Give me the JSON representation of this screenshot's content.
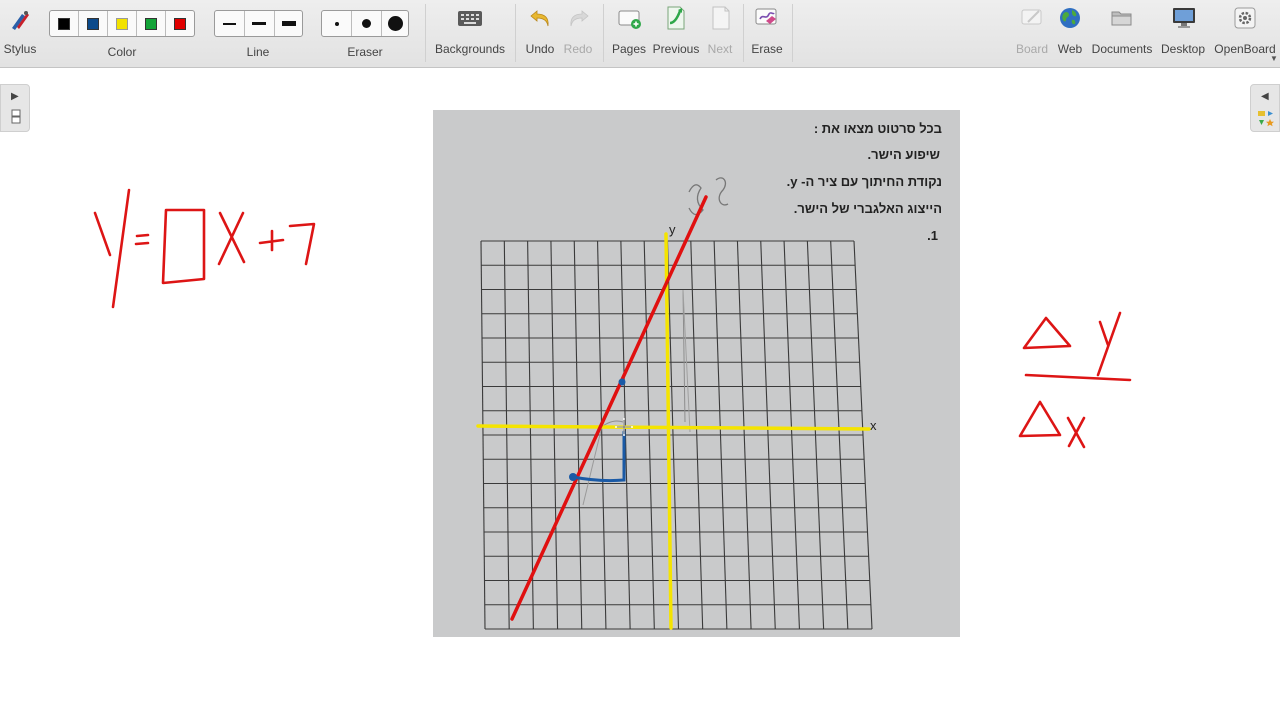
{
  "toolbar": {
    "stylus": "Stylus",
    "color": "Color",
    "line": "Line",
    "eraser": "Eraser",
    "backgrounds": "Backgrounds",
    "undo": "Undo",
    "redo": "Redo",
    "pages": "Pages",
    "previous": "Previous",
    "next": "Next",
    "erase": "Erase",
    "board": "Board",
    "web": "Web",
    "documents": "Documents",
    "desktop": "Desktop",
    "openboard": "OpenBoard"
  },
  "colors": [
    "#000000",
    "#0b4a8b",
    "#f2e200",
    "#13a338",
    "#e00000"
  ],
  "ink_colors": {
    "red": "#e01010",
    "yellow": "#f5e400",
    "blue": "#1a5aa6"
  },
  "worksheet": {
    "lines": [
      "בכל סרטוט מצאו את :",
      "שיפוע הישר.",
      "נקודת החיתוך עם ציר ה- y.",
      "הייצוג האלגברי של הישר.",
      "1."
    ],
    "x_axis": "x",
    "y_axis": "y"
  }
}
